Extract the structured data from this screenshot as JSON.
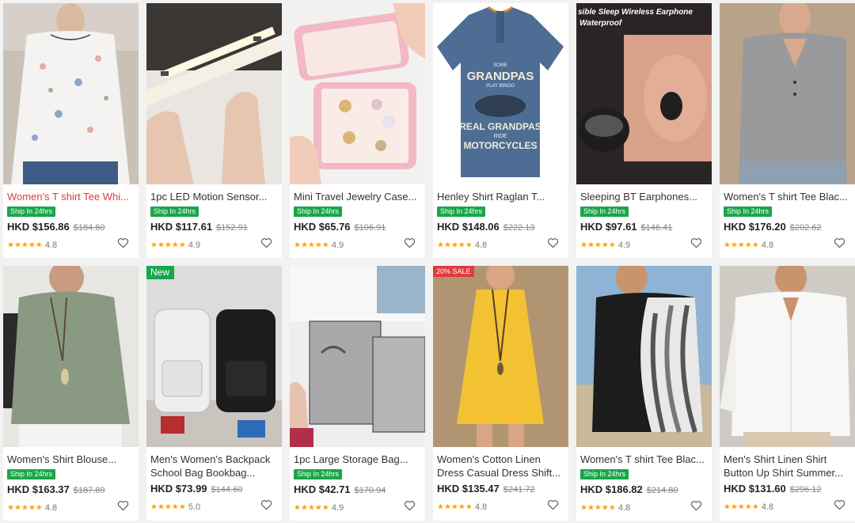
{
  "products": [
    {
      "title": "Women's T shirt Tee Whi...",
      "title_red": true,
      "ship": "Ship In 24hrs",
      "price": "HKD $156.86",
      "orig": "$184.60",
      "rating": "4.8",
      "stars": "★★★★★",
      "image": "floral-top-photo"
    },
    {
      "title": "1pc LED Motion Sensor...",
      "ship": "Ship In 24hrs",
      "price": "HKD $117.61",
      "orig": "$152.91",
      "rating": "4.9",
      "stars": "★★★★★",
      "image": "led-light-photo"
    },
    {
      "title": "Mini Travel Jewelry Case...",
      "ship": "Ship In 24hrs",
      "price": "HKD $65.76",
      "orig": "$106.91",
      "rating": "4.9",
      "stars": "★★★★★",
      "image": "jewelry-case-photo"
    },
    {
      "title": "Henley Shirt Raglan T...",
      "ship": "Ship In 24hrs",
      "price": "HKD $148.06",
      "orig": "$222.13",
      "rating": "4.8",
      "stars": "★★★★★",
      "image": "henley-shirt-photo",
      "shirt_text": [
        "SOME",
        "GRANDPAS",
        "PLAY BINGO",
        "REAL GRANDPAS",
        "RIDE",
        "MOTORCYCLES"
      ]
    },
    {
      "title": "Sleeping BT Earphones...",
      "ship": "Ship In 24hrs",
      "price": "HKD $97.61",
      "orig": "$146.41",
      "rating": "4.9",
      "stars": "★★★★★",
      "image": "earphones-photo",
      "overlay_text": [
        "sible Sleep Wireless Earphone",
        "Waterproof"
      ]
    },
    {
      "title": "Women's T shirt Tee Blac...",
      "ship": "Ship In 24hrs",
      "price": "HKD $176.20",
      "orig": "$202.62",
      "rating": "4.8",
      "stars": "★★★★★",
      "image": "grey-top-photo"
    },
    {
      "title": "Women's Shirt Blouse...",
      "ship": "Ship In 24hrs",
      "price": "HKD $163.37",
      "orig": "$187.89",
      "rating": "4.8",
      "stars": "★★★★★",
      "image": "sage-blouse-photo"
    },
    {
      "title_lines": [
        "Men's Women's Backpack",
        "School Bag Bookbag..."
      ],
      "badge": "New",
      "price": "HKD $73.99",
      "orig": "$144.60",
      "rating": "5.0",
      "stars": "★★★★★",
      "image": "backpack-photo"
    },
    {
      "title": "1pc Large Storage Bag...",
      "ship": "Ship In 24hrs",
      "price": "HKD $42.71",
      "orig": "$170.94",
      "rating": "4.9",
      "stars": "★★★★★",
      "image": "storage-bag-photo"
    },
    {
      "title_lines": [
        "Women's Cotton Linen",
        "Dress Casual Dress Shift..."
      ],
      "badge": "20% SALE",
      "price": "HKD $135.47",
      "orig": "$241.72",
      "rating": "4.8",
      "stars": "★★★★★",
      "image": "yellow-dress-photo"
    },
    {
      "title": "Women's T shirt Tee Blac...",
      "ship": "Ship In 24hrs",
      "price": "HKD $186.82",
      "orig": "$214.80",
      "rating": "4.8",
      "stars": "★★★★★",
      "image": "striped-top-photo"
    },
    {
      "title_lines": [
        "Men's Shirt Linen Shirt",
        "Button Up Shirt Summer..."
      ],
      "price": "HKD $131.60",
      "orig": "$296.12",
      "rating": "4.8",
      "stars": "★★★★★",
      "image": "linen-shirt-photo"
    }
  ],
  "icons": {
    "heart": "heart-outline-icon",
    "star": "star-icon"
  },
  "colors": {
    "ship_badge": "#1aa64a",
    "star": "#f8a51b",
    "title_red": "#e4393c",
    "sale_badge": "#e4393c"
  }
}
